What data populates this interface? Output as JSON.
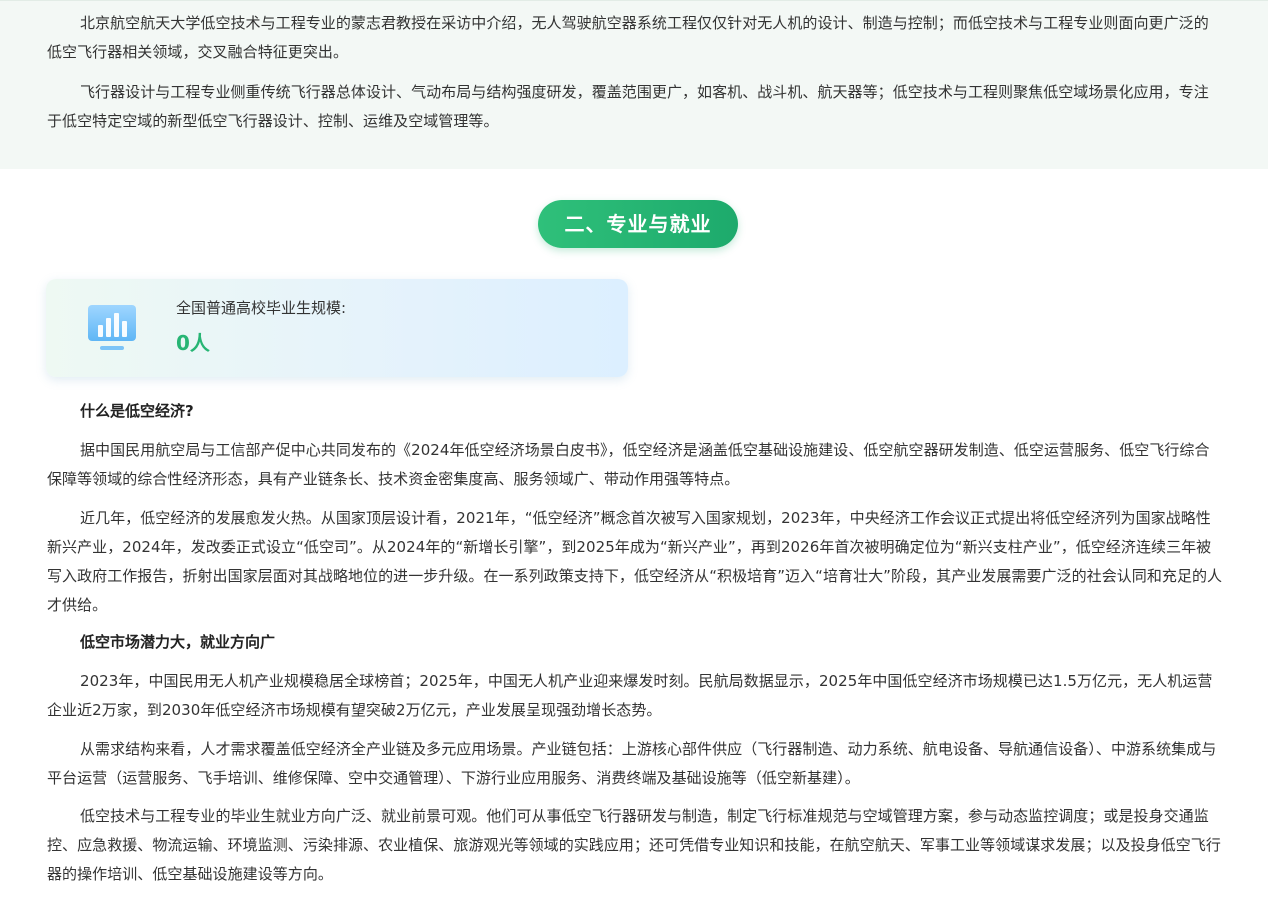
{
  "intro": {
    "p1": "北京航空航天大学低空技术与工程专业的蒙志君教授在采访中介绍，无人驾驶航空器系统工程仅仅针对无人机的设计、制造与控制；而低空技术与工程专业则面向更广泛的低空飞行器相关领域，交叉融合特征更突出。",
    "p2": "飞行器设计与工程专业侧重传统飞行器总体设计、气动布局与结构强度研发，覆盖范围更广，如客机、战斗机、航天器等；低空技术与工程则聚焦低空域场景化应用，专注于低空特定空域的新型低空飞行器设计、控制、运维及空域管理等。"
  },
  "section": {
    "title": "二、专业与就业"
  },
  "stat_card": {
    "icon": "bar-chart-monitor-icon",
    "label": "全国普通高校毕业生规模:",
    "value": "0人",
    "value_color": "#27b574"
  },
  "content": {
    "heading1": "什么是低空经济?",
    "p1": "据中国民用航空局与工信部产促中心共同发布的《2024年低空经济场景白皮书》，低空经济是涵盖低空基础设施建设、低空航空器研发制造、低空运营服务、低空飞行综合保障等领域的综合性经济形态，具有产业链条长、技术资金密集度高、服务领域广、带动作用强等特点。",
    "p2": "近几年，低空经济的发展愈发火热。从国家顶层设计看，2021年，“低空经济”概念首次被写入国家规划，2023年，中央经济工作会议正式提出将低空经济列为国家战略性新兴产业，2024年，发改委正式设立“低空司”。从2024年的“新增长引擎”，到2025年成为“新兴产业”，再到2026年首次被明确定位为“新兴支柱产业”，低空经济连续三年被写入政府工作报告，折射出国家层面对其战略地位的进一步升级。在一系列政策支持下，低空经济从“积极培育”迈入“培育壮大”阶段，其产业发展需要广泛的社会认同和充足的人才供给。",
    "heading2": "低空市场潜力大，就业方向广",
    "p3": "2023年，中国民用无人机产业规模稳居全球榜首；2025年，中国无人机产业迎来爆发时刻。民航局数据显示，2025年中国低空经济市场规模已达1.5万亿元，无人机运营企业近2万家，到2030年低空经济市场规模有望突破2万亿元，产业发展呈现强劲增长态势。",
    "p4": "从需求结构来看，人才需求覆盖低空经济全产业链及多元应用场景。产业链包括：上游核心部件供应（飞行器制造、动力系统、航电设备、导航通信设备）、中游系统集成与平台运营（运营服务、飞手培训、维修保障、空中交通管理）、下游行业应用服务、消费终端及基础设施等（低空新基建）。",
    "p5": "低空技术与工程专业的毕业生就业方向广泛、就业前景可观。他们可从事低空飞行器研发与制造，制定飞行标准规范与空域管理方案，参与动态监控调度；或是投身交通监控、应急救援、物流运输、环境监测、污染排源、农业植保、旅游观光等领域的实践应用；还可凭借专业知识和技能，在航空航天、军事工业等领域谋求发展；以及投身低空飞行器的操作培训、低空基础设施建设等方向。"
  }
}
